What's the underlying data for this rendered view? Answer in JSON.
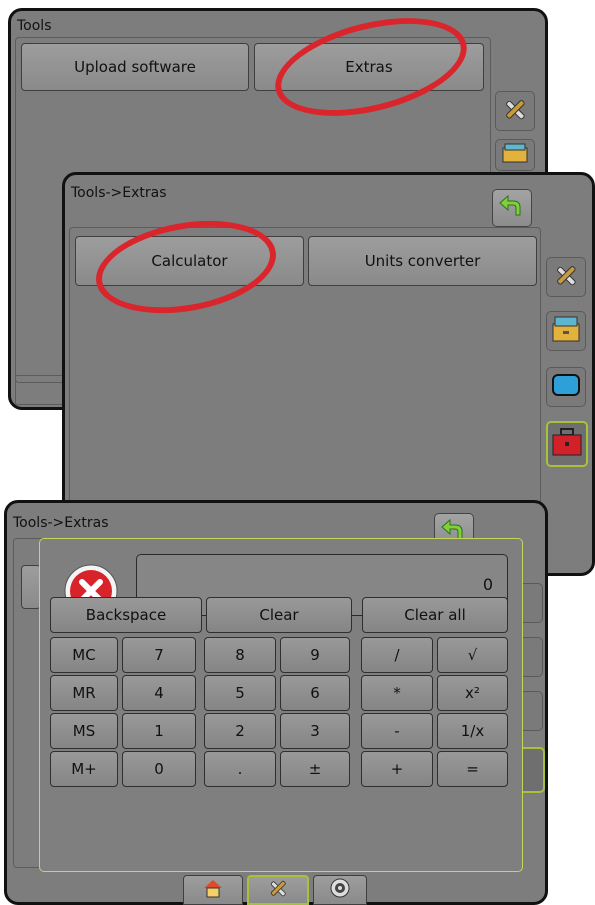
{
  "screen1": {
    "breadcrumb": "Tools",
    "tabs": [
      "Upload software",
      "Extras"
    ]
  },
  "screen2": {
    "breadcrumb": "Tools->Extras",
    "buttons": [
      "Calculator",
      "Units converter"
    ]
  },
  "screen3": {
    "breadcrumb": "Tools->Extras",
    "display_value": "0",
    "top_keys": [
      "Backspace",
      "Clear",
      "Clear all"
    ],
    "keys": [
      [
        "MC",
        "7",
        "8",
        "9",
        "/",
        "√"
      ],
      [
        "MR",
        "4",
        "5",
        "6",
        "*",
        "x²"
      ],
      [
        "MS",
        "1",
        "2",
        "3",
        "-",
        "1/x"
      ],
      [
        "M+",
        "0",
        ".",
        "±",
        "+",
        "="
      ]
    ]
  },
  "colors": {
    "panel": "#7d7d7d",
    "highlight": "#d9252b",
    "accent": "#a6c23a"
  },
  "icons": [
    "tools-icon",
    "console-icon",
    "display-icon",
    "toolbox-icon",
    "back-arrow-icon",
    "error-icon",
    "home-icon",
    "gps-icon"
  ]
}
